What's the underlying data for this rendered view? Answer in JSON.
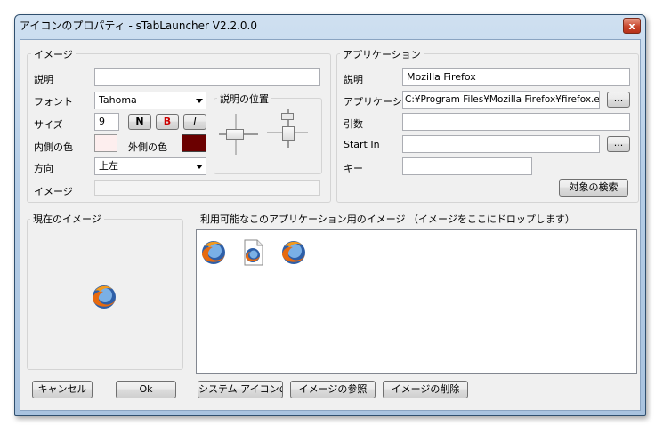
{
  "window": {
    "title": "アイコンのプロパティ - sTabLauncher V2.2.0.0",
    "close": "x"
  },
  "image_group": {
    "title": "イメージ",
    "desc_label": "説明",
    "desc_value": "",
    "font_label": "フォント",
    "font_value": "Tahoma",
    "size_label": "サイズ",
    "size_value": "9",
    "btn_n": "N",
    "btn_b": "B",
    "btn_i": "I",
    "inner_color_label": "内側の色",
    "inner_color": "#fdeeee",
    "outer_color_label": "外側の色",
    "outer_color": "#6b0000",
    "direction_label": "方向",
    "direction_value": "上左",
    "image_label": "イメージ",
    "image_value": "",
    "position_group_title": "説明の位置"
  },
  "app_group": {
    "title": "アプリケーション",
    "desc_label": "説明",
    "desc_value": "Mozilla Firefox",
    "app_label": "アプリケーション",
    "app_value": "C:¥Program Files¥Mozilla Firefox¥firefox.exe",
    "browse_label": "...",
    "args_label": "引数",
    "args_value": "",
    "startin_label": "Start In",
    "startin_value": "",
    "browse2_label": "...",
    "key_label": "キー",
    "key_value": "",
    "search_button": "対象の検索"
  },
  "current_image": {
    "title": "現在のイメージ",
    "icon": "firefox-icon"
  },
  "available_images": {
    "title": "利用可能なこのアプリケーション用のイメージ （イメージをここにドロップします）",
    "icons": [
      "firefox-icon",
      "firefox-document-icon",
      "firefox-icon"
    ]
  },
  "buttons": {
    "cancel": "キャンセル",
    "ok": "Ok",
    "system_icons": "システム アイコンの",
    "browse_image": "イメージの参照",
    "delete_image": "イメージの削除"
  }
}
